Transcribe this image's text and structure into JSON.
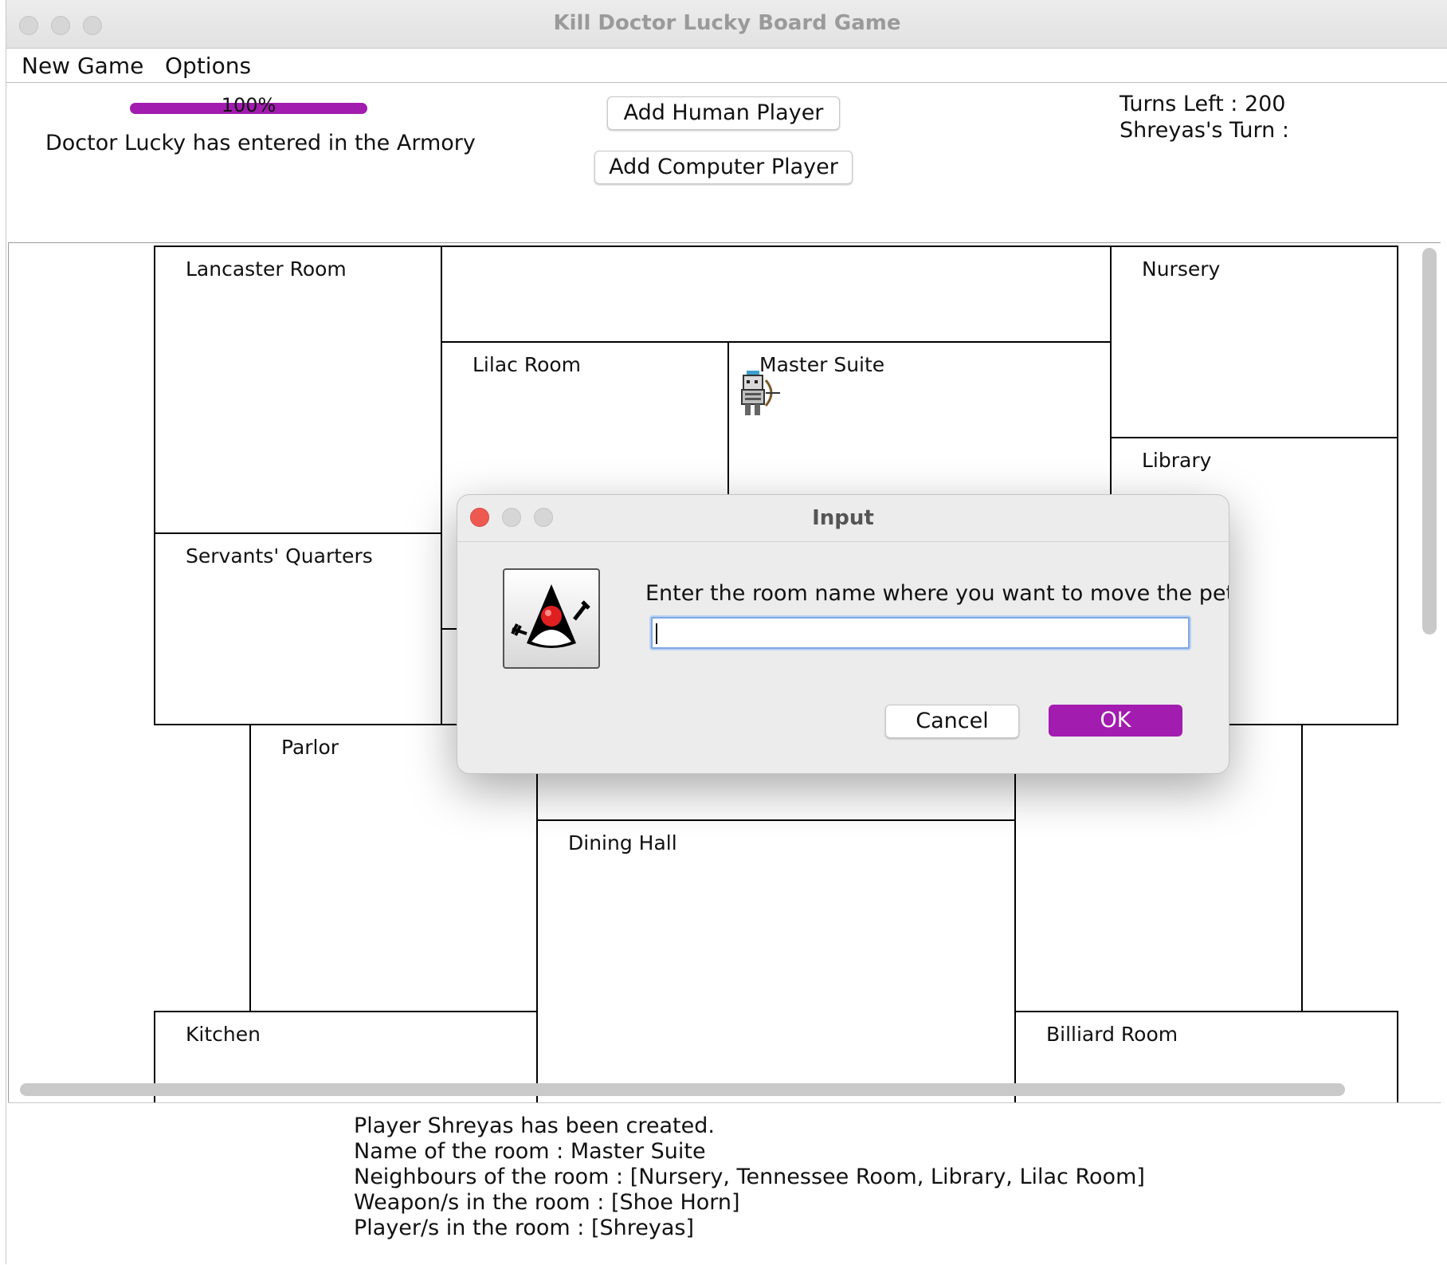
{
  "window": {
    "title": "Kill Doctor Lucky Board Game"
  },
  "menu": {
    "items": [
      "New Game",
      "Options"
    ]
  },
  "top_panel": {
    "progress": {
      "percent_label": "100%",
      "value": 1.0,
      "color": "#a21caf"
    },
    "status_message": "Doctor Lucky has entered in the Armory",
    "add_human_label": "Add Human Player",
    "add_computer_label": "Add Computer Player",
    "turns_left": "Turns Left : 200",
    "current_turn": "Shreyas's Turn :"
  },
  "board": {
    "rooms": {
      "lancaster": "Lancaster Room",
      "nursery": "Nursery",
      "lilac": "Lilac Room",
      "master_suite": "Master Suite",
      "library": "Library",
      "servants": "Servants' Quarters",
      "parlor": "Parlor",
      "dining": "Dining Hall",
      "kitchen": "Kitchen",
      "billiard": "Billiard Room"
    },
    "pet_icon": "archer-pet-icon"
  },
  "log": {
    "lines": [
      "Player Shreyas has been created.",
      "Name of the room : Master Suite",
      "Neighbours of the room : [Nursery, Tennessee Room, Library, Lilac Room]",
      "Weapon/s in the room : [Shoe Horn]",
      "Player/s in the room : [Shreyas]"
    ]
  },
  "dialog": {
    "title": "Input",
    "message": "Enter the room name where you want to move the pet:",
    "input_value": "",
    "cancel_label": "Cancel",
    "ok_label": "OK",
    "ok_color": "#a21caf",
    "icon": "java-duke-icon"
  }
}
